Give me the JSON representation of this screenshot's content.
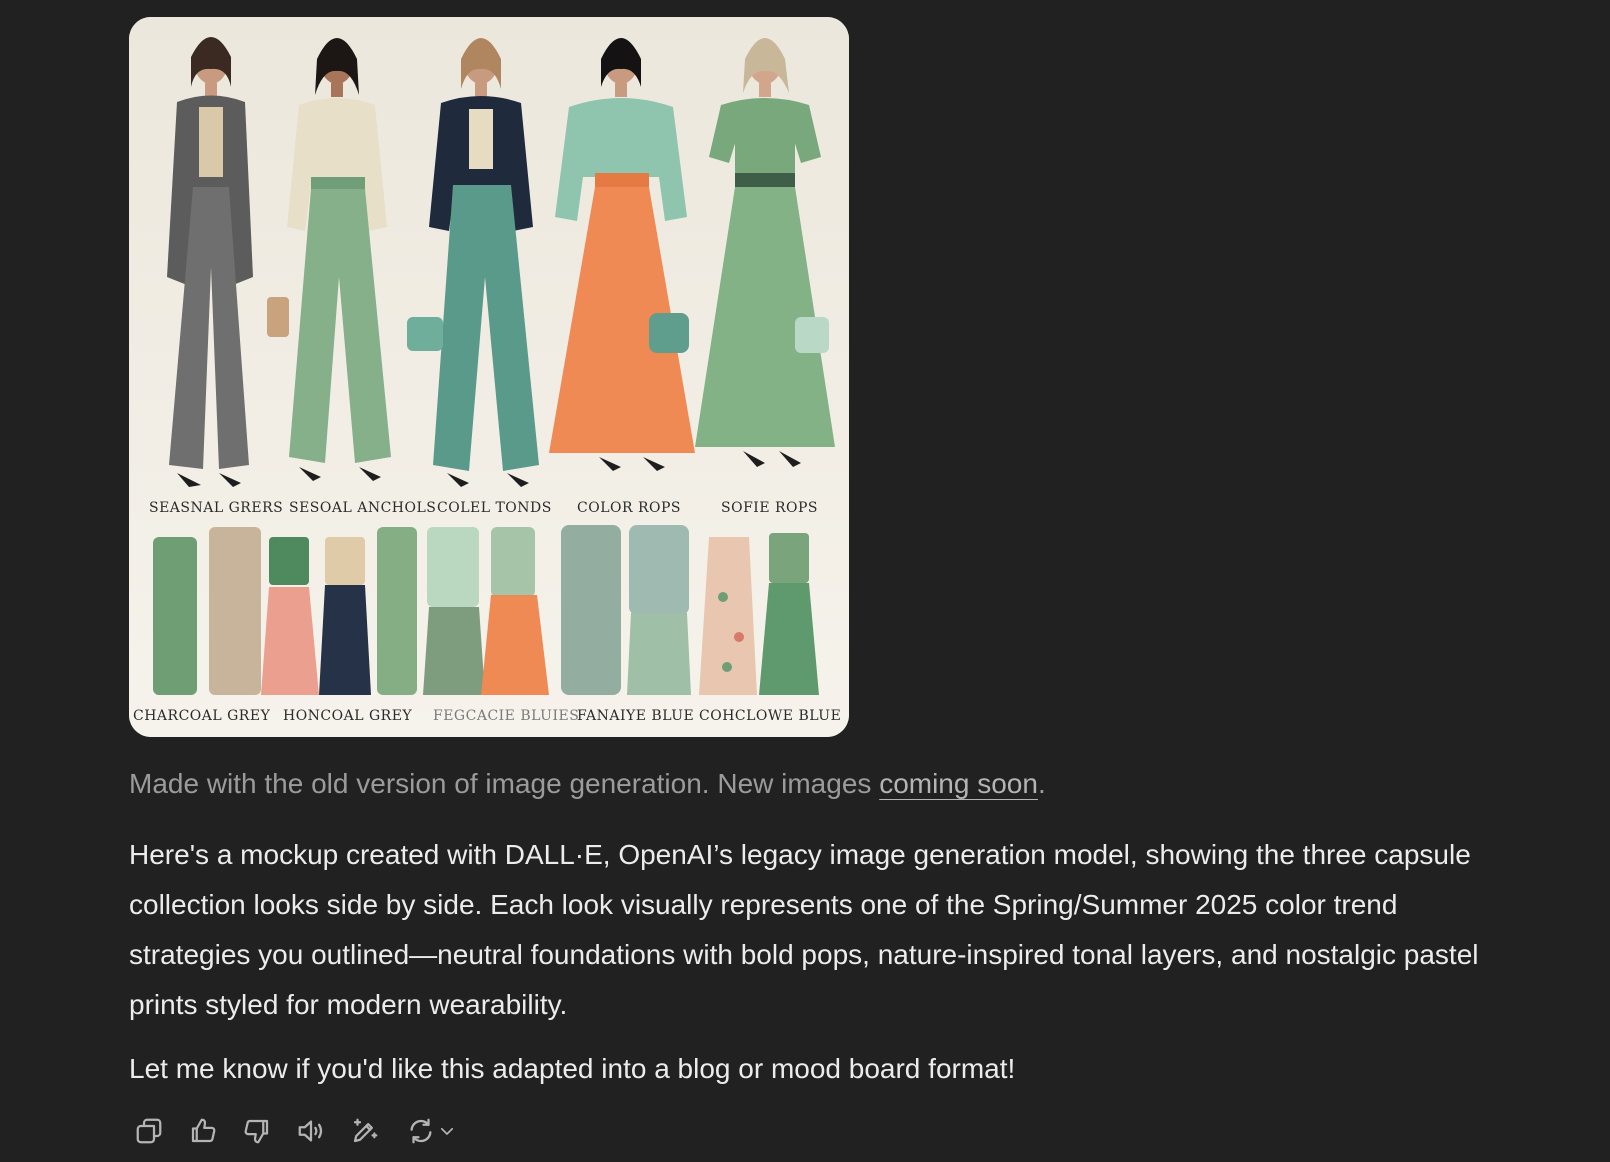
{
  "image": {
    "alt_icon": "generated-image",
    "row_labels_top": [
      "SEASNAL GRERS",
      "SESOAL ANCHOLS",
      "COLEL TONDS",
      "COLOR ROPS",
      "SOFIE ROPS"
    ],
    "row_labels_bottom": [
      "CHARCOAL GREY",
      "HONCOAL GREY",
      "FEGCACIE BLUIES",
      "FANAIYE BLUE",
      "COHCLOWE BLUE"
    ]
  },
  "caption": {
    "text": "Made with the old version of image generation. New images ",
    "link": "coming soon",
    "end": "."
  },
  "response": {
    "paragraph1": "Here's a mockup created with DALL·E, OpenAI’s legacy image generation model, showing the three capsule collection looks side by side. Each look visually represents one of the Spring/Summer 2025 color trend strategies you outlined—neutral foundations with bold pops, nature-inspired tonal layers, and nostalgic pastel prints styled for modern wearability.",
    "paragraph2": "Let me know if you'd like this adapted into a blog or mood board format!"
  },
  "actions": {
    "copy": "copy-icon",
    "like": "thumbs-up-icon",
    "dislike": "thumbs-down-icon",
    "read_aloud": "speaker-icon",
    "edit": "edit-icon",
    "regenerate": "regenerate-icon"
  },
  "colors": {
    "background": "#212121",
    "text": "#ececec",
    "muted": "#9b9b9b"
  }
}
